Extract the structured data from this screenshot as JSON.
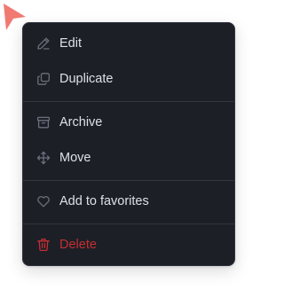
{
  "colors": {
    "menu_background": "#1c1f26",
    "text": "#dde0e6",
    "icon": "#6b707c",
    "danger": "#c62e33",
    "cursor": "#f07a72"
  },
  "menu": {
    "items": [
      {
        "label": "Edit",
        "icon": "pencil-icon"
      },
      {
        "label": "Duplicate",
        "icon": "copy-icon"
      },
      {
        "label": "Archive",
        "icon": "archive-box-icon"
      },
      {
        "label": "Move",
        "icon": "move-arrows-icon"
      },
      {
        "label": "Add to favorites",
        "icon": "heart-icon"
      },
      {
        "label": "Delete",
        "icon": "trash-icon",
        "danger": true
      }
    ]
  }
}
